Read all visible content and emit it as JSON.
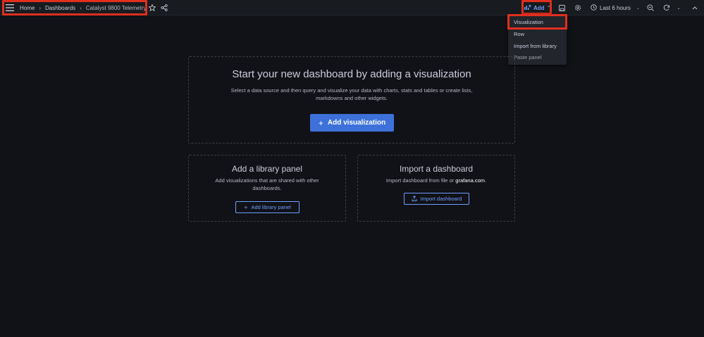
{
  "breadcrumb": {
    "home": "Home",
    "dashboards": "Dashboards",
    "current": "Catalyst 9800 Telemetry"
  },
  "toolbar": {
    "add_label": "Add",
    "time_range": "Last 6 hours"
  },
  "add_menu": {
    "items": [
      "Visualization",
      "Row",
      "Import from library",
      "Paste panel"
    ]
  },
  "empty_state": {
    "title": "Start your new dashboard by adding a visualization",
    "description_line1": "Select a data source and then query and visualize your data with charts, stats and tables or create lists,",
    "description_line2": "markdowns and other widgets.",
    "button": "Add visualization"
  },
  "library_panel": {
    "title": "Add a library panel",
    "description_line1": "Add visualizations that are shared with other",
    "description_line2": "dashboards.",
    "button": "Add library panel"
  },
  "import_panel": {
    "title": "Import a dashboard",
    "description_prefix": "Import dashboard from file or ",
    "description_link": "grafana.com",
    "description_suffix": ".",
    "button": "Import dashboard"
  },
  "colors": {
    "background": "#111217",
    "topbar": "#181b1f",
    "accent": "#3d71d9",
    "link": "#6e9fff",
    "highlight": "#e02f1f"
  }
}
